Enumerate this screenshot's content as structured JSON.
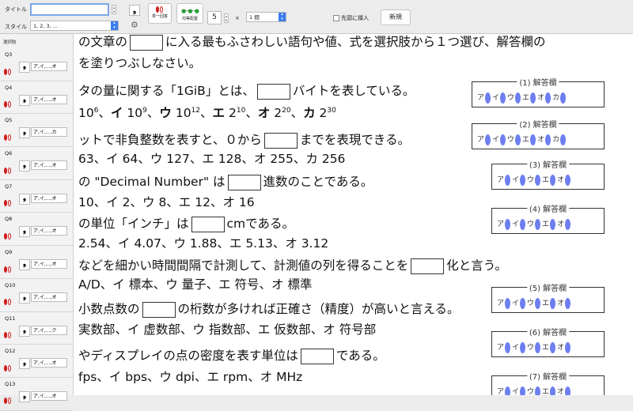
{
  "toolbar": {
    "title_label": "タイトル",
    "title_value": "",
    "style_label": "スタイル",
    "style_value": "1, 2, 3, ...",
    "comma_glyph": "❟",
    "single_label": "単一回答",
    "even_label": "均等配置",
    "count_value": "5",
    "times": "×",
    "unit_value": "1 個",
    "insert_label": "先頭に挿入",
    "new_label": "新規"
  },
  "sidebar": {
    "header": "選択肢",
    "items": [
      {
        "name": "Q3",
        "style": "ア,イ,...,オ"
      },
      {
        "name": "Q4",
        "style": "ア,イ,...,オ"
      },
      {
        "name": "Q5",
        "style": "ア,イ,...,カ"
      },
      {
        "name": "Q6",
        "style": "ア,イ,...,オ"
      },
      {
        "name": "Q7",
        "style": "ア,イ,...,オ"
      },
      {
        "name": "Q8",
        "style": "ア,イ,...,オ"
      },
      {
        "name": "Q9",
        "style": "ア,イ,...,オ"
      },
      {
        "name": "Q10",
        "style": "ア,イ,...,オ"
      },
      {
        "name": "Q11",
        "style": "ア,イ,...,ク"
      },
      {
        "name": "Q12",
        "style": "ア,イ,...,オ"
      },
      {
        "name": "Q13",
        "style": "ア,イ,...,オ"
      }
    ]
  },
  "doc": {
    "intro1a": "の文章の",
    "intro1b": "に入る最もふさわしい語句や値、式を選択肢から１つ選び、解答欄の",
    "intro2": "を塗りつぶしなさい。",
    "q1a": "タの量に関する「1GiB」とは、",
    "q1b": "バイトを表している。",
    "q1opts": "10",
    "q2a": "ットで非負整数を表すと、０から",
    "q2b": "までを表現できる。",
    "q2opts": "63、イ 64、ウ 127、エ 128、オ 255、カ 256",
    "q3a": "の \"Decimal Number\" は",
    "q3b": "進数のことである。",
    "q3opts": "10、イ 2、ウ 8、エ 12、オ 16",
    "q4a": "の単位「インチ」は",
    "q4b": "cmである。",
    "q4opts": "2.54、イ 4.07、ウ 1.88、エ 5.13、オ 3.12",
    "q5a": "などを細かい時間間隔で計測して、計測値の列を得ることを",
    "q5b": "化と言う。",
    "q5opts": "A/D、イ 標本、ウ 量子、エ 符号、オ 標準",
    "q6a": "小数点数の",
    "q6b": "の桁数が多ければ正確さ（精度）が高いと言える。",
    "q6opts": "実数部、イ 虚数部、ウ 指数部、エ 仮数部、オ 符号部",
    "q7a": "やディスプレイの点の密度を表す単位は",
    "q7b": "である。",
    "q7opts": "fps、イ bps、ウ dpi、エ rpm、オ MHz"
  },
  "answers": [
    {
      "title": "(1) 解答欄",
      "opts": [
        "ア",
        "イ",
        "ウ",
        "エ",
        "オ",
        "カ"
      ]
    },
    {
      "title": "(2) 解答欄",
      "opts": [
        "ア",
        "イ",
        "ウ",
        "エ",
        "オ",
        "カ"
      ]
    },
    {
      "title": "(3) 解答欄",
      "opts": [
        "ア",
        "イ",
        "ウ",
        "エ",
        "オ"
      ]
    },
    {
      "title": "(4) 解答欄",
      "opts": [
        "ア",
        "イ",
        "ウ",
        "エ",
        "オ"
      ]
    },
    {
      "title": "(5) 解答欄",
      "opts": [
        "ア",
        "イ",
        "ウ",
        "エ",
        "オ"
      ]
    },
    {
      "title": "(6) 解答欄",
      "opts": [
        "ア",
        "イ",
        "ウ",
        "エ",
        "オ"
      ]
    },
    {
      "title": "(7) 解答欄",
      "opts": [
        "ア",
        "イ",
        "ウ",
        "エ",
        "オ"
      ]
    }
  ],
  "colors": {
    "bubble": "#6d7ff0",
    "oval": "#d11a1a",
    "green": "#2a9d3a"
  }
}
